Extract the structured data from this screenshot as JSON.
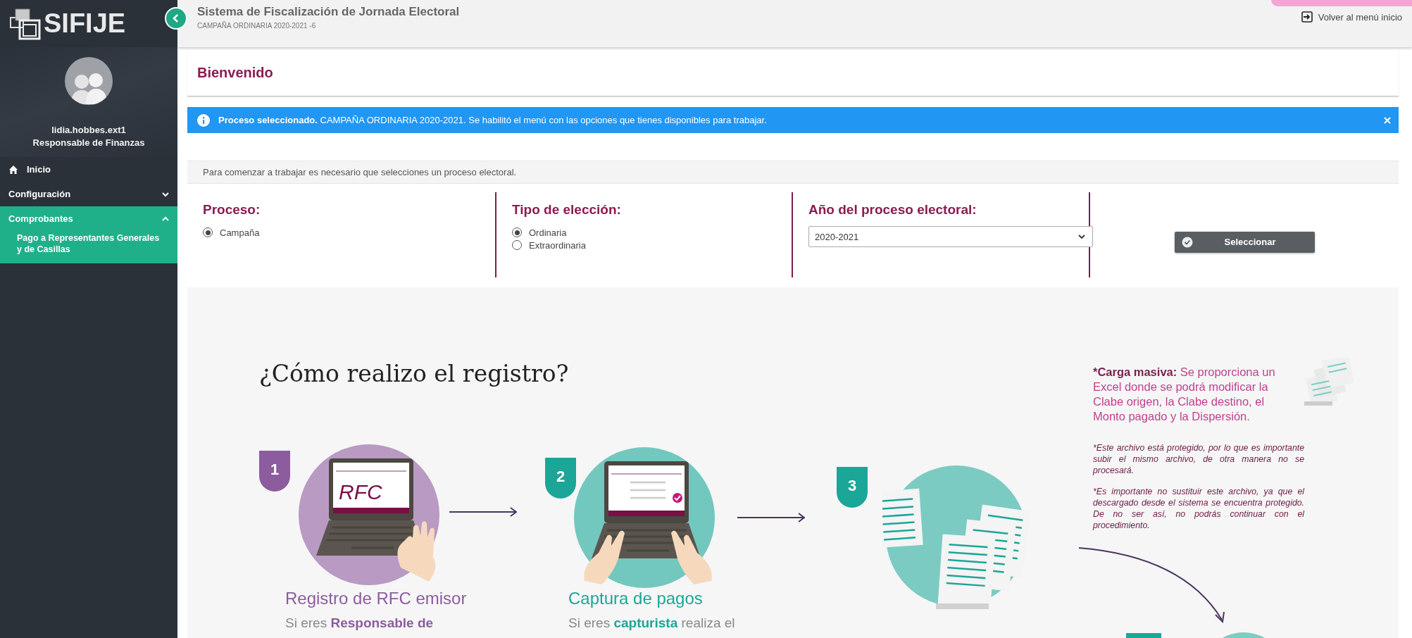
{
  "app": {
    "name": "SIFIJE"
  },
  "user": {
    "name": "lidia.hobbes.ext1",
    "role": "Responsable de Finanzas"
  },
  "sidebar": {
    "items": [
      {
        "label": "Inicio",
        "kind": "link"
      },
      {
        "label": "Configuración",
        "kind": "group",
        "expanded": false
      },
      {
        "label": "Comprobantes",
        "kind": "group",
        "expanded": true,
        "children": [
          {
            "label": "Pago a Representantes Generales y de Casillas"
          }
        ]
      }
    ]
  },
  "header": {
    "title": "Sistema de Fiscalización de Jornada Electoral",
    "subtitle": "CAMPAÑA ORDINARIA 2020-2021 -6",
    "back_link": "Volver al menú inicio"
  },
  "welcome": {
    "title": "Bienvenido"
  },
  "alert": {
    "text": "**Proceso seleccionado.** CAMPAÑA ORDINARIA 2020-2021. Se habilitó el menú con las opciones que tienes disponibles para trabajar."
  },
  "instruction": "Para comenzar a trabajar es necesario que selecciones un proceso electoral.",
  "form": {
    "groups": [
      {
        "kind": "radio",
        "label": "Proceso:",
        "options": [
          {
            "label": "Campaña",
            "selected": true
          }
        ]
      },
      {
        "kind": "radio",
        "label": "Tipo de elección:",
        "options": [
          {
            "label": "Ordinaria",
            "selected": true
          },
          {
            "label": "Extraordinaria",
            "selected": false
          }
        ]
      },
      {
        "kind": "select",
        "label": "Año del proceso electoral:",
        "value": "2020-2021"
      }
    ],
    "button": "Seleccionar"
  },
  "guide": {
    "title": "¿Cómo realizo el registro?",
    "steps": [
      {
        "number": "1",
        "kind": "rfc-laptop",
        "color": "#8c5c9e",
        "screen_text": "RFC",
        "title": "Registro de RFC emisor",
        "text": "Si eres **Responsable de**"
      },
      {
        "number": "2",
        "kind": "form-laptop",
        "color": "#1ba698",
        "title": "Captura de pagos",
        "text": "Si eres **capturista** realiza el"
      },
      {
        "number": "3",
        "kind": "documents",
        "color": "#1ba698"
      }
    ],
    "note": {
      "lead_label": "*Carga masiva:",
      "lead": "Se proporciona un Excel donde se podrá modificar la Clabe origen, la Clabe destino, el Monto pagado y la Dispersión.",
      "details": [
        "*Este archivo está protegido, por lo que es importante subir el mismo archivo, de otra manera no se procesará.",
        "*Es importante no sustituir este archivo, ya que el descargado desde el sistema se encuentra protegido. De no ser así, no podrás continuar con el procedimiento."
      ]
    }
  }
}
